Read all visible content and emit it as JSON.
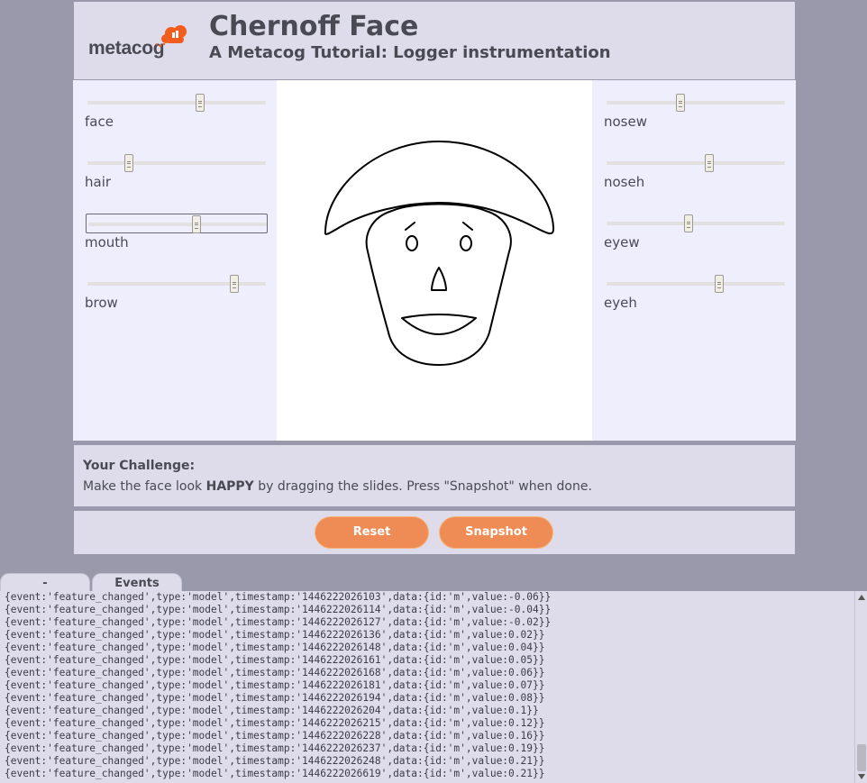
{
  "header": {
    "logo_text": "metacog",
    "title": "Chernoff Face",
    "subtitle": "A Metacog Tutorial: Logger instrumentation"
  },
  "sliders_left": [
    {
      "label": "face",
      "value": 0.64
    },
    {
      "label": "hair",
      "value": 0.22
    },
    {
      "label": "mouth",
      "value": 0.61,
      "focused": true
    },
    {
      "label": "brow",
      "value": 0.84
    }
  ],
  "sliders_right": [
    {
      "label": "nosew",
      "value": 0.41
    },
    {
      "label": "noseh",
      "value": 0.58
    },
    {
      "label": "eyew",
      "value": 0.46
    },
    {
      "label": "eyeh",
      "value": 0.64
    }
  ],
  "challenge": {
    "title": "Your Challenge:",
    "text_pre": "Make the face look ",
    "text_bold": "HAPPY",
    "text_post": " by dragging the slides. Press \"Snapshot\" when done."
  },
  "buttons": {
    "reset": "Reset",
    "snapshot": "Snapshot"
  },
  "tabs": {
    "minimize": "-",
    "events": "Events"
  },
  "log": [
    "{event:'feature_changed',type:'model',timestamp:'1446222026103',data:{id:'m',value:-0.06}}",
    "{event:'feature_changed',type:'model',timestamp:'1446222026114',data:{id:'m',value:-0.04}}",
    "{event:'feature_changed',type:'model',timestamp:'1446222026127',data:{id:'m',value:-0.02}}",
    "{event:'feature_changed',type:'model',timestamp:'1446222026136',data:{id:'m',value:0.02}}",
    "{event:'feature_changed',type:'model',timestamp:'1446222026148',data:{id:'m',value:0.04}}",
    "{event:'feature_changed',type:'model',timestamp:'1446222026161',data:{id:'m',value:0.05}}",
    "{event:'feature_changed',type:'model',timestamp:'1446222026168',data:{id:'m',value:0.06}}",
    "{event:'feature_changed',type:'model',timestamp:'1446222026181',data:{id:'m',value:0.07}}",
    "{event:'feature_changed',type:'model',timestamp:'1446222026194',data:{id:'m',value:0.08}}",
    "{event:'feature_changed',type:'model',timestamp:'1446222026204',data:{id:'m',value:0.1}}",
    "{event:'feature_changed',type:'model',timestamp:'1446222026215',data:{id:'m',value:0.12}}",
    "{event:'feature_changed',type:'model',timestamp:'1446222026228',data:{id:'m',value:0.16}}",
    "{event:'feature_changed',type:'model',timestamp:'1446222026237',data:{id:'m',value:0.19}}",
    "{event:'feature_changed',type:'model',timestamp:'1446222026248',data:{id:'m',value:0.21}}",
    "{event:'feature_changed',type:'model',timestamp:'1446222026619',data:{id:'m',value:0.21}}"
  ],
  "colors": {
    "accent": "#ef8c55",
    "panel": "#efeefc",
    "chrome": "#dedcea",
    "background": "#9a99ab",
    "text": "#4a4a55"
  }
}
